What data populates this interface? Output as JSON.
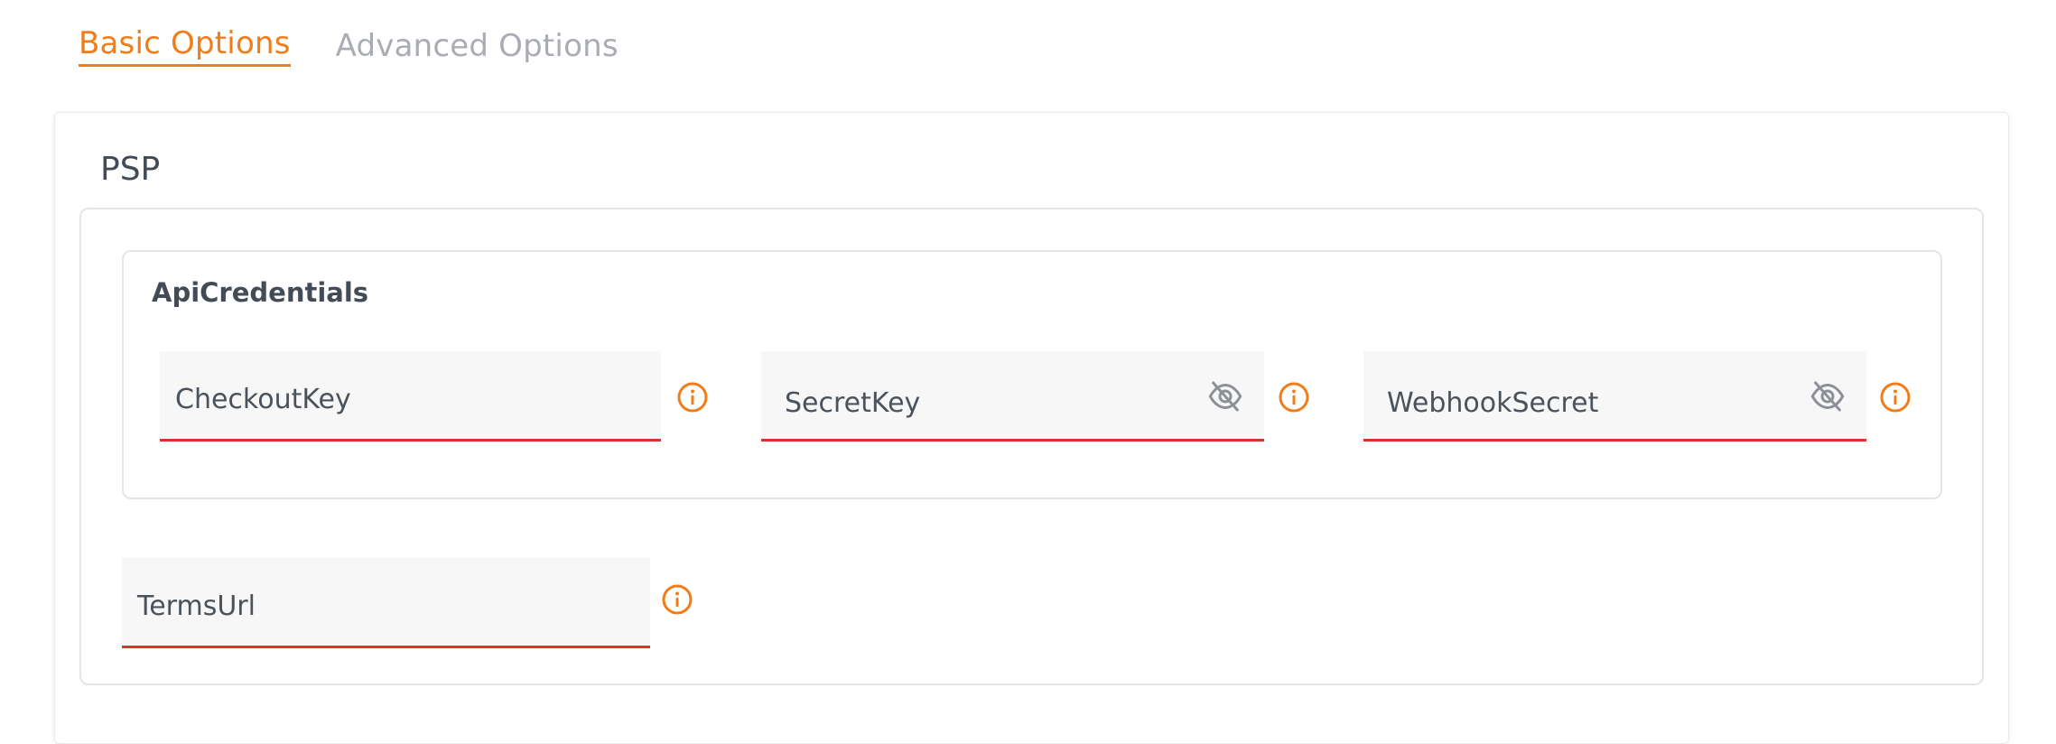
{
  "tabs": [
    {
      "label": "Basic Options",
      "active": true
    },
    {
      "label": "Advanced Options",
      "active": false
    }
  ],
  "card": {
    "title": "PSP"
  },
  "api_credentials": {
    "title": "ApiCredentials",
    "fields": [
      {
        "label": "CheckoutKey",
        "value": "",
        "secret": false,
        "icon": "info-icon"
      },
      {
        "label": "SecretKey",
        "value": "",
        "secret": true,
        "icon": "eye-slash-icon"
      },
      {
        "label": "WebhookSecret",
        "value": "",
        "secret": true,
        "icon": "eye-slash-icon"
      }
    ]
  },
  "terms": {
    "label": "TermsUrl",
    "value": ""
  },
  "colors": {
    "accent": "#f07d19",
    "error_underline": "#d9332b",
    "inactive_tab": "#a9adb3",
    "field_bg": "#f7f7f7",
    "border": "#e3e5e8"
  }
}
